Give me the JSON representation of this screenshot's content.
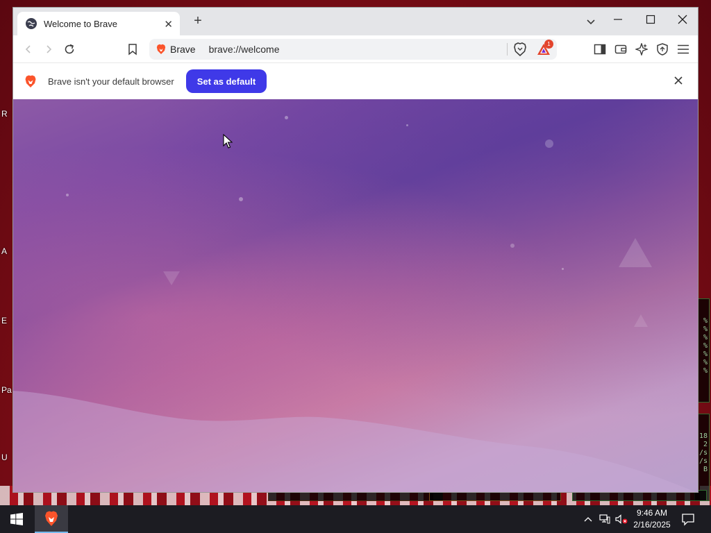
{
  "desktop": {
    "edge_labels": [
      "R",
      "A",
      "E",
      "Pa",
      "U"
    ],
    "widget_right_upper": [
      "%",
      "%",
      "%",
      "%",
      "%",
      "%",
      "%"
    ],
    "widget_right_lower": [
      "18",
      "2",
      "/s",
      "/s",
      "B"
    ]
  },
  "browser": {
    "tab": {
      "title": "Welcome to Brave",
      "favicon": "globe-icon"
    },
    "address_bar": {
      "brand": "Brave",
      "url": "brave://welcome"
    },
    "rewards_badge": "1",
    "infobar": {
      "message": "Brave isn't your default browser",
      "button_label": "Set as default"
    },
    "colors": {
      "button_bg": "#3f39e8",
      "lion_orange": "#fb542b",
      "titlebar_bg": "#e4e5e8",
      "content_purple": "#7b4aa4",
      "content_pink": "#c27ba6"
    }
  },
  "taskbar": {
    "clock_time": "9:46 AM",
    "clock_date": "2/16/2025"
  }
}
